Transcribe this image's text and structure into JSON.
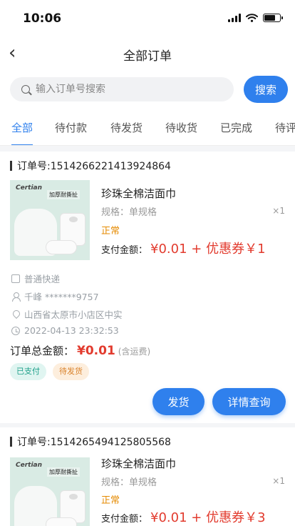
{
  "status_bar": {
    "time": "10:06"
  },
  "nav": {
    "title": "全部订单"
  },
  "search": {
    "placeholder": "输入订单号搜索",
    "button": "搜索"
  },
  "tabs": [
    {
      "label": "全部",
      "active": true
    },
    {
      "label": "待付款"
    },
    {
      "label": "待发货"
    },
    {
      "label": "待收货"
    },
    {
      "label": "已完成"
    },
    {
      "label": "待评"
    }
  ],
  "orders": [
    {
      "order_label": "订单号:1514266221413924864",
      "product": {
        "brand": "Certian",
        "image_badge": "加厚耐撕扯",
        "name": "珍珠全棉洁面巾",
        "spec": "规格：单规格",
        "qty": "×1",
        "state": "正常",
        "pay_label": "支付金额：",
        "pay_amount": "¥0.01 + 优惠券￥1"
      },
      "delivery": "普通快递",
      "receiver": "千峰 *******9757",
      "address": "山西省太原市小店区中实",
      "time": "2022-04-13 23:32:53",
      "total_label": "订单总金额：",
      "total_amount": "¥0.01",
      "total_note": "(含运费)",
      "tags": [
        "已支付",
        "待发货"
      ],
      "buttons": [
        "发货",
        "详情查询"
      ]
    },
    {
      "order_label": "订单号:1514265494125805568",
      "product": {
        "brand": "Certian",
        "image_badge": "加厚耐撕扯",
        "name": "珍珠全棉洁面巾",
        "spec": "规格：单规格",
        "qty": "×1",
        "state": "正常",
        "pay_label": "支付金额：",
        "pay_amount": "¥0.01 + 优惠券￥3"
      }
    }
  ],
  "colors": {
    "accent": "#2f80ed",
    "price": "#e23b2e",
    "state": "#e58a00"
  }
}
